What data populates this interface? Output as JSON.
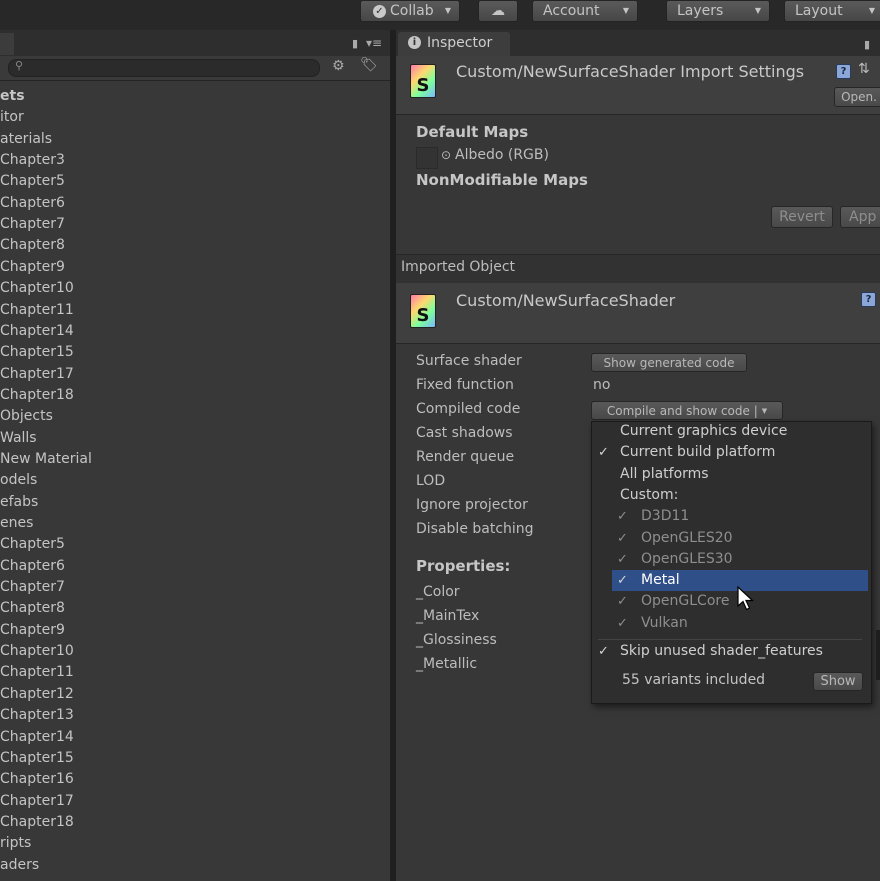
{
  "toolbar": {
    "collab_label": "Collab",
    "account_label": "Account",
    "layers_label": "Layers",
    "layout_label": "Layout"
  },
  "project": {
    "items": [
      {
        "label": "ets",
        "bold": true
      },
      {
        "label": "itor"
      },
      {
        "label": "aterials"
      },
      {
        "label": "Chapter3"
      },
      {
        "label": "Chapter5"
      },
      {
        "label": "Chapter6"
      },
      {
        "label": "Chapter7"
      },
      {
        "label": "Chapter8"
      },
      {
        "label": "Chapter9"
      },
      {
        "label": "Chapter10"
      },
      {
        "label": "Chapter11"
      },
      {
        "label": "Chapter14"
      },
      {
        "label": "Chapter15"
      },
      {
        "label": "Chapter17"
      },
      {
        "label": "Chapter18"
      },
      {
        "label": "Objects"
      },
      {
        "label": "Walls"
      },
      {
        "label": "New Material"
      },
      {
        "label": "odels"
      },
      {
        "label": "efabs"
      },
      {
        "label": "enes"
      },
      {
        "label": "Chapter5"
      },
      {
        "label": "Chapter6"
      },
      {
        "label": "Chapter7"
      },
      {
        "label": "Chapter8"
      },
      {
        "label": "Chapter9"
      },
      {
        "label": "Chapter10"
      },
      {
        "label": "Chapter11"
      },
      {
        "label": "Chapter12"
      },
      {
        "label": "Chapter13"
      },
      {
        "label": "Chapter14"
      },
      {
        "label": "Chapter15"
      },
      {
        "label": "Chapter16"
      },
      {
        "label": "Chapter17"
      },
      {
        "label": "Chapter18"
      },
      {
        "label": "ripts"
      },
      {
        "label": "aders"
      }
    ]
  },
  "inspector": {
    "tab_label": "Inspector",
    "import_title": "Custom/NewSurfaceShader Import Settings",
    "open_label": "Open.",
    "default_maps": "Default Maps",
    "albedo_label": "Albedo (RGB)",
    "nonmodifiable_maps": "NonModifiable Maps",
    "revert_label": "Revert",
    "apply_label": "App",
    "imported_object": "Imported Object",
    "shader_title": "Custom/NewSurfaceShader",
    "shader_icon_letter": "S",
    "props": [
      {
        "label": "Surface shader"
      },
      {
        "label": "Fixed function",
        "value": "no"
      },
      {
        "label": "Compiled code"
      },
      {
        "label": "Cast shadows"
      },
      {
        "label": "Render queue"
      },
      {
        "label": "LOD"
      },
      {
        "label": "Ignore projector"
      },
      {
        "label": "Disable batching"
      }
    ],
    "show_generated_code": "Show generated code",
    "compile_show_code": "Compile and show code |",
    "properties_heading": "Properties:",
    "properties": [
      "_Color",
      "_MainTex",
      "_Glossiness",
      "_Metallic"
    ]
  },
  "dropdown": {
    "items": [
      {
        "label": "Current graphics device",
        "checked": false
      },
      {
        "label": "Current build platform",
        "checked": true
      },
      {
        "label": "All platforms",
        "checked": false
      },
      {
        "label": "Custom:",
        "checked": false
      },
      {
        "label": "D3D11",
        "checked": true,
        "dim": true
      },
      {
        "label": "OpenGLES20",
        "checked": true,
        "dim": true
      },
      {
        "label": "OpenGLES30",
        "checked": true,
        "dim": true
      },
      {
        "label": "Metal",
        "checked": true,
        "highlighted": true
      },
      {
        "label": "OpenGLCore",
        "checked": true,
        "dim": true
      },
      {
        "label": "Vulkan",
        "checked": true,
        "dim": true
      }
    ],
    "skip_label": "Skip unused shader_features",
    "variants_label": "55 variants included",
    "show_label": "Show"
  },
  "colors": {
    "highlight": "#2f4f88",
    "panel": "#383838",
    "menu_bg": "#2d2d2d"
  }
}
